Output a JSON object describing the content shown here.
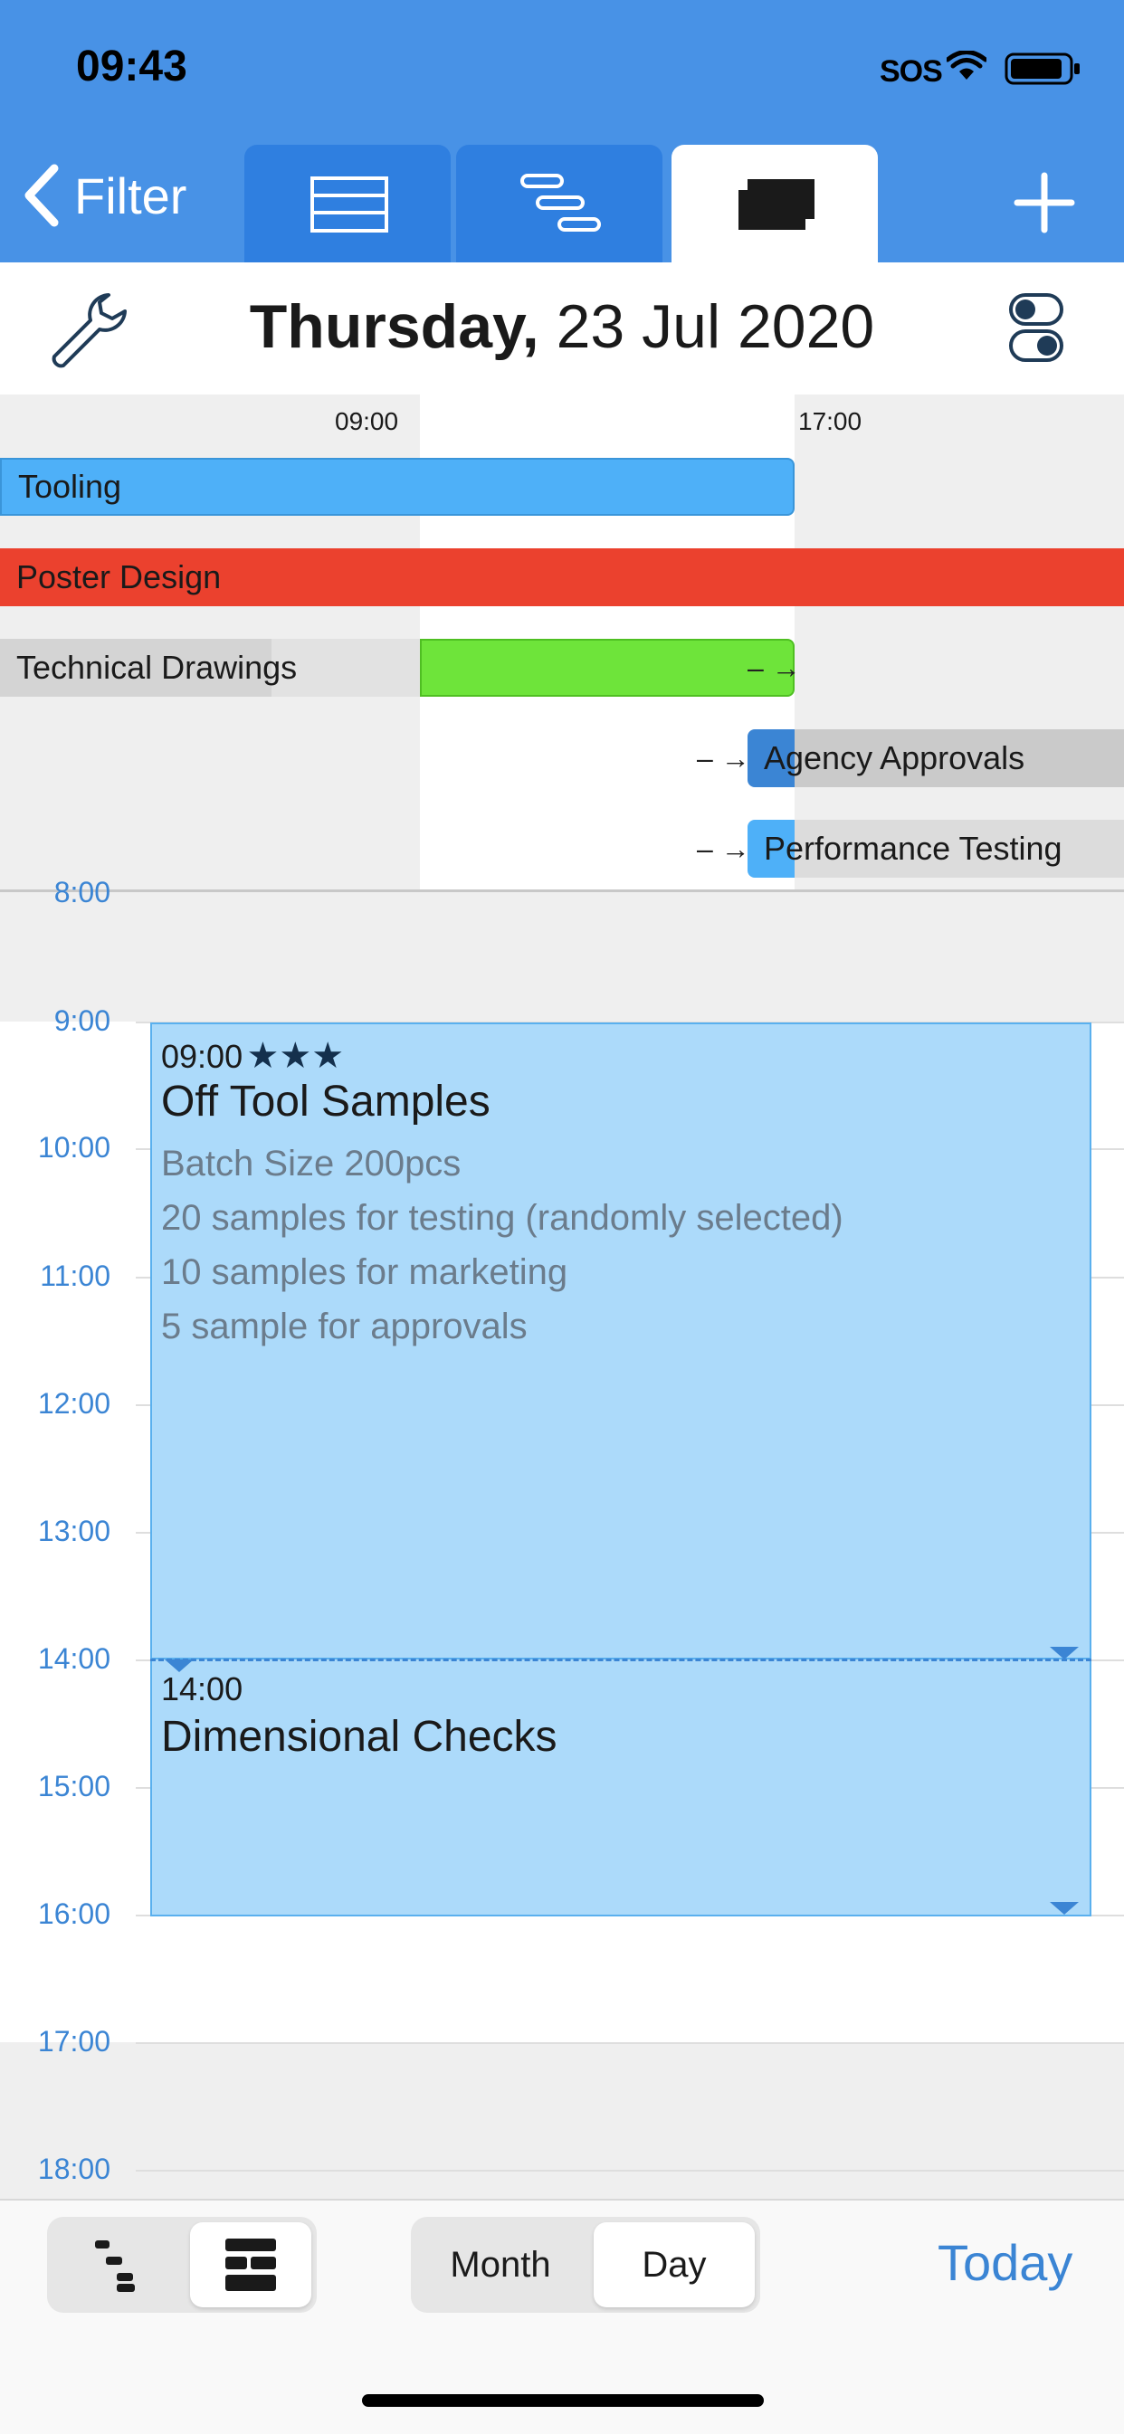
{
  "status_bar": {
    "time": "09:43",
    "carrier": "SOS"
  },
  "nav": {
    "back_label": "Filter",
    "tabs": [
      {
        "icon": "list-view-icon",
        "selected": false
      },
      {
        "icon": "gantt-view-icon",
        "selected": false
      },
      {
        "icon": "calendar-cards-icon",
        "selected": true
      }
    ],
    "add_icon": "plus-icon"
  },
  "date_header": {
    "weekday": "Thursday,",
    "date": "23 Jul 2020"
  },
  "gantt": {
    "ticks": [
      "09:00",
      "17:00"
    ],
    "tasks": [
      {
        "label": "Tooling",
        "color": "#4eb0f8"
      },
      {
        "label": "Poster Design",
        "color": "#eb412e"
      },
      {
        "label": "Technical Drawings",
        "color": "#6ee43a"
      },
      {
        "label": "Agency Approvals",
        "color": "#3b85d4"
      },
      {
        "label": "Performance Testing",
        "color": "#4eb0f8"
      }
    ]
  },
  "timeline": {
    "hours": [
      "8:00",
      "9:00",
      "10:00",
      "11:00",
      "12:00",
      "13:00",
      "14:00",
      "15:00",
      "16:00",
      "17:00",
      "18:00"
    ],
    "events": [
      {
        "time": "09:00",
        "stars": "★★★",
        "title": "Off Tool Samples",
        "notes": [
          "Batch Size 200pcs",
          "20 samples for testing (randomly selected)",
          "10 samples for marketing",
          "5 sample for approvals"
        ]
      },
      {
        "time": "14:00",
        "title": "Dimensional Checks"
      }
    ]
  },
  "bottom_bar": {
    "view_mode_selected": "cards",
    "range": {
      "month": "Month",
      "day": "Day",
      "selected": "Day"
    },
    "today": "Today"
  },
  "colors": {
    "header": "#4892e6",
    "accent": "#3b85d4",
    "event_fill": "#acdafa"
  }
}
